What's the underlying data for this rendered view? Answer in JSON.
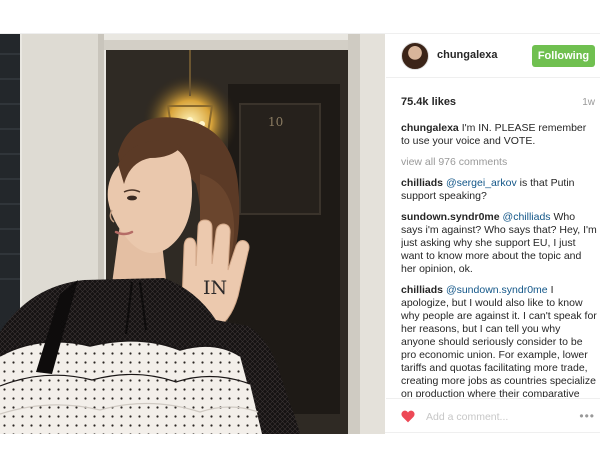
{
  "post": {
    "username": "chungalexa",
    "follow_label": "Following",
    "likes": "75.4k likes",
    "age": "1w",
    "caption": {
      "user": "chungalexa",
      "text": "I'm IN. PLEASE remember to use your voice and VOTE."
    },
    "view_all": "view all 976 comments",
    "comments": [
      {
        "user": "chilliads",
        "mention": "@sergei_arkov",
        "text": "is that Putin support speaking?"
      },
      {
        "user": "sundown.syndr0me",
        "mention": "@chilliads",
        "text": "Who says i'm against? Who says that? Hey, I'm just asking why she support EU, I just want to know more about the topic and her opinion, ok."
      },
      {
        "user": "chilliads",
        "mention": "@sundown.syndr0me",
        "text": "I apologize, but I would also like to know why people are against it. I can't speak for her reasons, but I can tell you why anyone should seriously consider to be pro economic union. For example, lower tariffs and quotas facilitating more trade, creating more jobs as countries specialize on production where their comparative advantage is. This in turn"
      }
    ],
    "comment_placeholder": "Add a comment...",
    "more_label": "•••",
    "hand_text": "IN"
  },
  "colors": {
    "follow_button": "#70c050",
    "mention": "#125688",
    "heart": "#ed4956",
    "muted": "#999999"
  },
  "icons": {
    "like": "heart-icon",
    "options": "more-options-icon"
  }
}
